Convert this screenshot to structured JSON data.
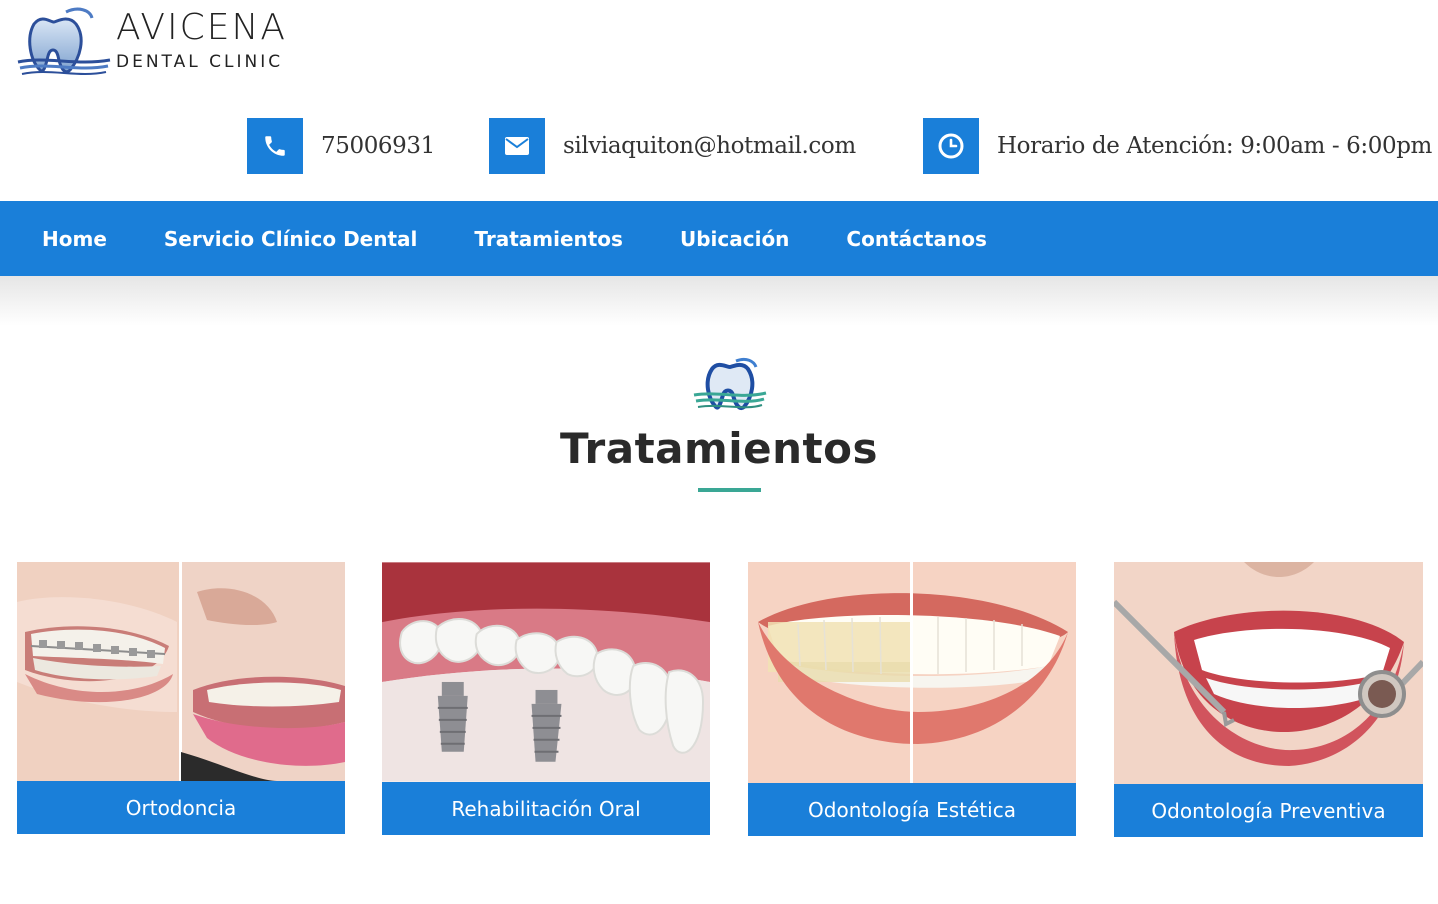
{
  "brand": {
    "name": "AVICENA",
    "subtitle": "DENTAL CLINIC"
  },
  "contact": {
    "phone": {
      "icon": "phone-icon",
      "text": "75006931"
    },
    "email": {
      "icon": "envelope-icon",
      "text": "silviaquiton@hotmail.com"
    },
    "hours": {
      "icon": "clock-icon",
      "text": "Horario de Atención: 9:00am - 6:00pm"
    }
  },
  "nav": {
    "items": [
      {
        "label": "Home"
      },
      {
        "label": "Servicio Clínico Dental"
      },
      {
        "label": "Tratamientos"
      },
      {
        "label": "Ubicación"
      },
      {
        "label": "Contáctanos"
      }
    ]
  },
  "section": {
    "icon": "tooth-logo-icon",
    "title": "Tratamientos"
  },
  "treatments": [
    {
      "label": "Ortodoncia",
      "image": "braces-comparison-image"
    },
    {
      "label": "Rehabilitación Oral",
      "image": "dental-implant-image"
    },
    {
      "label": "Odontología Estética",
      "image": "whitening-comparison-image"
    },
    {
      "label": "Odontología Preventiva",
      "image": "dental-checkup-image"
    }
  ],
  "colors": {
    "primary": "#1a7fd9",
    "accent": "#3aa795",
    "text": "#333333"
  }
}
